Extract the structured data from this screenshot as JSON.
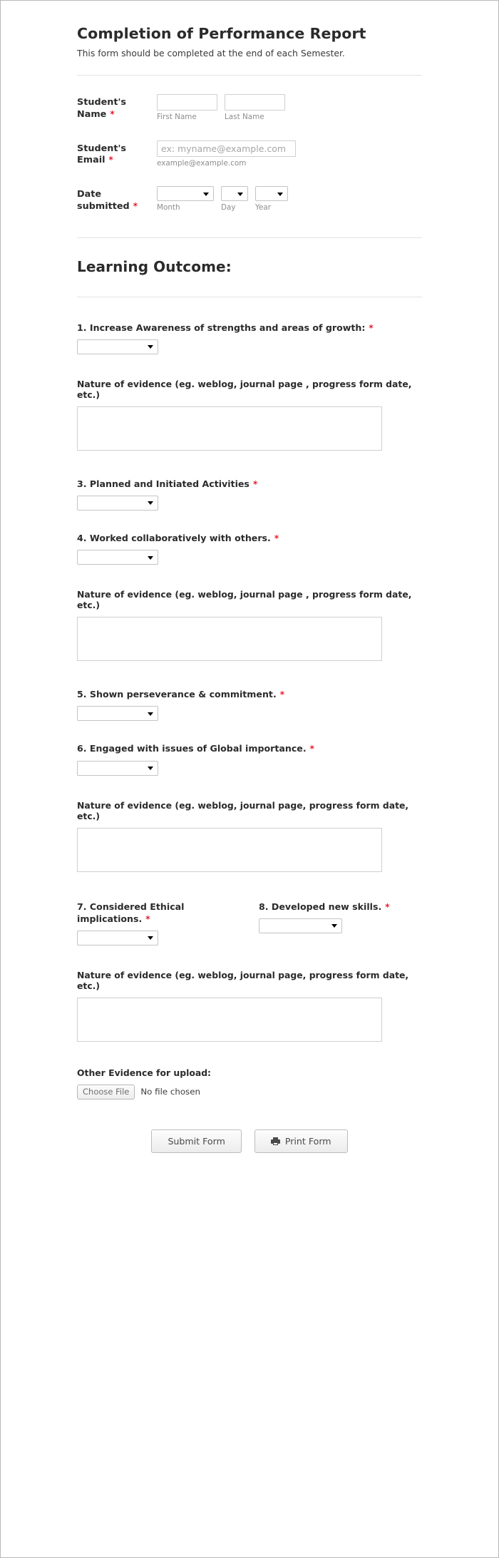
{
  "header": {
    "title": "Completion of Performance Report",
    "subtitle": "This form should be completed at the end of each Semester."
  },
  "fields": {
    "student_name": {
      "label": "Student's Name",
      "required_mark": "*",
      "first_sub_label": "First Name",
      "last_sub_label": "Last Name",
      "first_value": "",
      "last_value": "",
      "first_placeholder": "",
      "last_placeholder": ""
    },
    "student_email": {
      "label": "Student's Email",
      "required_mark": "*",
      "placeholder": "ex: myname@example.com",
      "value": "",
      "sub_label": "example@example.com"
    },
    "date_submitted": {
      "label": "Date submitted",
      "required_mark": "*",
      "month_sub_label": "Month",
      "day_sub_label": "Day",
      "year_sub_label": "Year",
      "month_value": "",
      "day_value": "",
      "year_value": ""
    }
  },
  "section": {
    "heading": "Learning Outcome",
    "heading_colon": ":"
  },
  "questions": [
    {
      "id": "q1",
      "label": "1.  Increase Awareness of strengths and areas of growth:",
      "required_mark": "*",
      "select_value": ""
    },
    {
      "id": "q3",
      "label": "3. Planned and Initiated Activities",
      "required_mark": "*",
      "select_value": ""
    },
    {
      "id": "q4",
      "label": "4. Worked collaboratively with others.",
      "required_mark": "*",
      "select_value": ""
    },
    {
      "id": "q5",
      "label": "5. Shown perseverance & commitment.",
      "required_mark": "*",
      "select_value": ""
    },
    {
      "id": "q6",
      "label": "6. Engaged with issues of Global importance.",
      "required_mark": "*",
      "select_value": ""
    },
    {
      "id": "q7",
      "label": "7. Considered Ethical implications.",
      "required_mark": "*",
      "select_value": ""
    },
    {
      "id": "q8",
      "label": "8. Developed new skills.",
      "required_mark": "*",
      "select_value": ""
    }
  ],
  "evidence_blocks": [
    {
      "id": "evidence1",
      "label": "Nature of evidence (eg. weblog, journal page , progress form date, etc.)",
      "value": ""
    },
    {
      "id": "evidence2",
      "label": "Nature of evidence (eg. weblog, journal page , progress form date, etc.)",
      "value": ""
    },
    {
      "id": "evidence3",
      "label": "Nature of evidence (eg. weblog, journal page, progress form date, etc.)",
      "value": ""
    },
    {
      "id": "evidence4",
      "label": "Nature of evidence (eg. weblog, journal page, progress form date, etc.)",
      "value": ""
    }
  ],
  "upload": {
    "label": "Other  Evidence for upload:",
    "button_label": "Choose File",
    "status_text": "No file chosen"
  },
  "footer": {
    "submit_label": "Submit Form",
    "print_label": "Print Form",
    "print_icon": "printer-icon"
  },
  "colors": {
    "required_red": "#e8192c",
    "text": "#2b2b2b",
    "border": "#cfcfcf",
    "sub_label": "#8d8d8d",
    "page_border": "#b9b9b9"
  }
}
